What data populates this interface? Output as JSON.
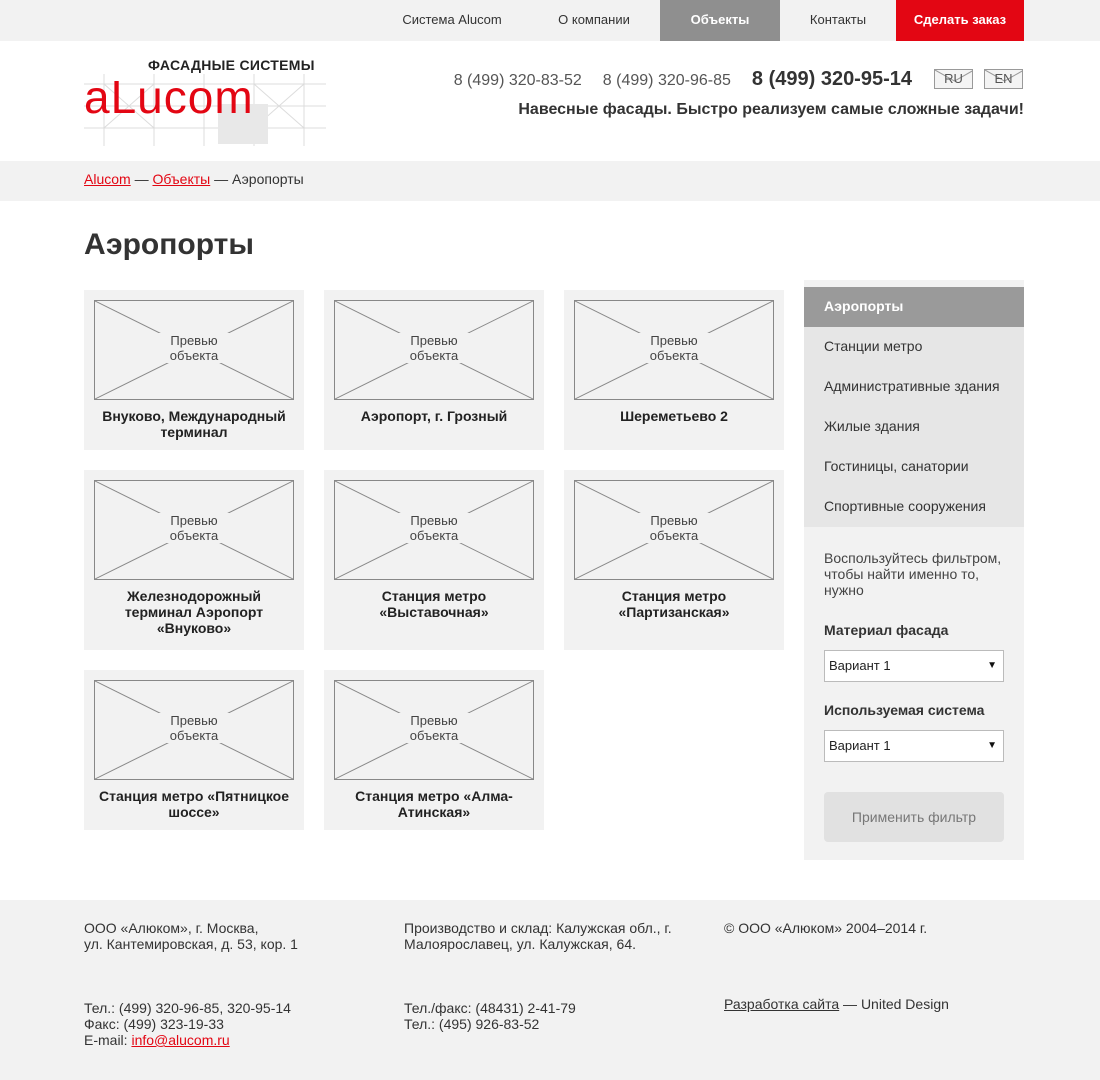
{
  "topnav": {
    "items": [
      "Система Alucom",
      "О компании",
      "Объекты",
      "Контакты",
      "Сделать заказ"
    ]
  },
  "header": {
    "logo_caption": "ФАСАДНЫЕ СИСТЕМЫ",
    "logo_word": "aLucom",
    "phones": [
      "8 (499) 320-83-52",
      "8 (499) 320-96-85",
      "8 (499) 320-95-14"
    ],
    "lang_ru": "RU",
    "lang_en": "EN",
    "slogan": "Навесные фасады. Быстро реализуем самые сложные задачи!"
  },
  "breadcrumb": {
    "home": "Alucom",
    "sep1": " — ",
    "section": "Объекты",
    "sep2": " — ",
    "current": "Аэропорты"
  },
  "page_title": "Аэропорты",
  "placeholder_line1": "Превью",
  "placeholder_line2": "объекта",
  "objects": [
    "Внуково, Международный терминал",
    "Аэропорт, г. Грозный",
    "Шереметьево 2",
    "Железнодорожный терминал Аэропорт «Внуково»",
    "Станция метро «Выставочная»",
    "Станция метро «Партизанская»",
    "Станция метро «Пятницкое шоссе»",
    "Станция метро «Алма-Атинская»"
  ],
  "sidebar": {
    "categories": [
      "Аэропорты",
      "Станции метро",
      "Административные здания",
      "Жилые здания",
      "Гостиницы, санатории",
      "Спортивные сооружения"
    ],
    "hint": "Воспользуйтесь фильтром, чтобы найти именно то, нужно",
    "material_label": "Материал фасада",
    "material_value": "Вариант 1",
    "system_label": "Используемая система",
    "system_value": "Вариант 1",
    "apply_label": "Применить фильтр"
  },
  "footer": {
    "address_l1": "ООО «Алюком», г. Москва,",
    "address_l2": "ул. Кантемировская, д. 53, кор. 1",
    "production_l1": "Производство и склад: Калужская обл., г.",
    "production_l2": "Малоярославец, ул. Калужская, 64.",
    "copyright": "© ООО «Алюком» 2004–2014 г.",
    "tel": "Тел.: (499) 320-96-85, 320-95-14",
    "fax": "Факс: (499) 323-19-33",
    "email_label": "E-mail:",
    "email": "info@alucom.ru",
    "telfax": "Тел./факс: (48431) 2-41-79",
    "tel2": "Тел.: (495) 926-83-52",
    "dev_link": "Разработка сайта",
    "dev_suffix": " — United Design"
  },
  "colors": {
    "brand_red": "#e30613",
    "active_gray": "#8f8f8f",
    "panel_bg": "#f2f2f2"
  }
}
